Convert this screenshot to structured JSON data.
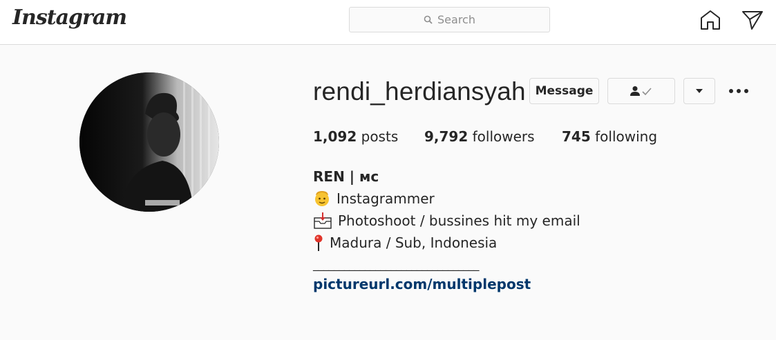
{
  "header": {
    "logo_text": "Instagram",
    "search_placeholder": "Search"
  },
  "profile": {
    "username": "rendi_herdiansyah",
    "buttons": {
      "message": "Message"
    },
    "stats": {
      "posts_count": "1,092",
      "posts_label": "posts",
      "followers_count": "9,792",
      "followers_label": "followers",
      "following_count": "745",
      "following_label": "following"
    },
    "bio": {
      "name": "REN | ᴍᴄ",
      "lines": [
        {
          "icon": "face-emoji-icon",
          "text": "Instagrammer"
        },
        {
          "icon": "inbox-tray-icon",
          "text": "Photoshoot / bussines hit my email"
        },
        {
          "icon": "round-pushpin-icon",
          "text": "Madura / Sub, Indonesia"
        }
      ],
      "divider": "________________________________",
      "link": "pictureurl.com/multiplepost"
    }
  },
  "colors": {
    "link": "#00376b",
    "border": "#dbdbdb",
    "background": "#fafafa"
  }
}
